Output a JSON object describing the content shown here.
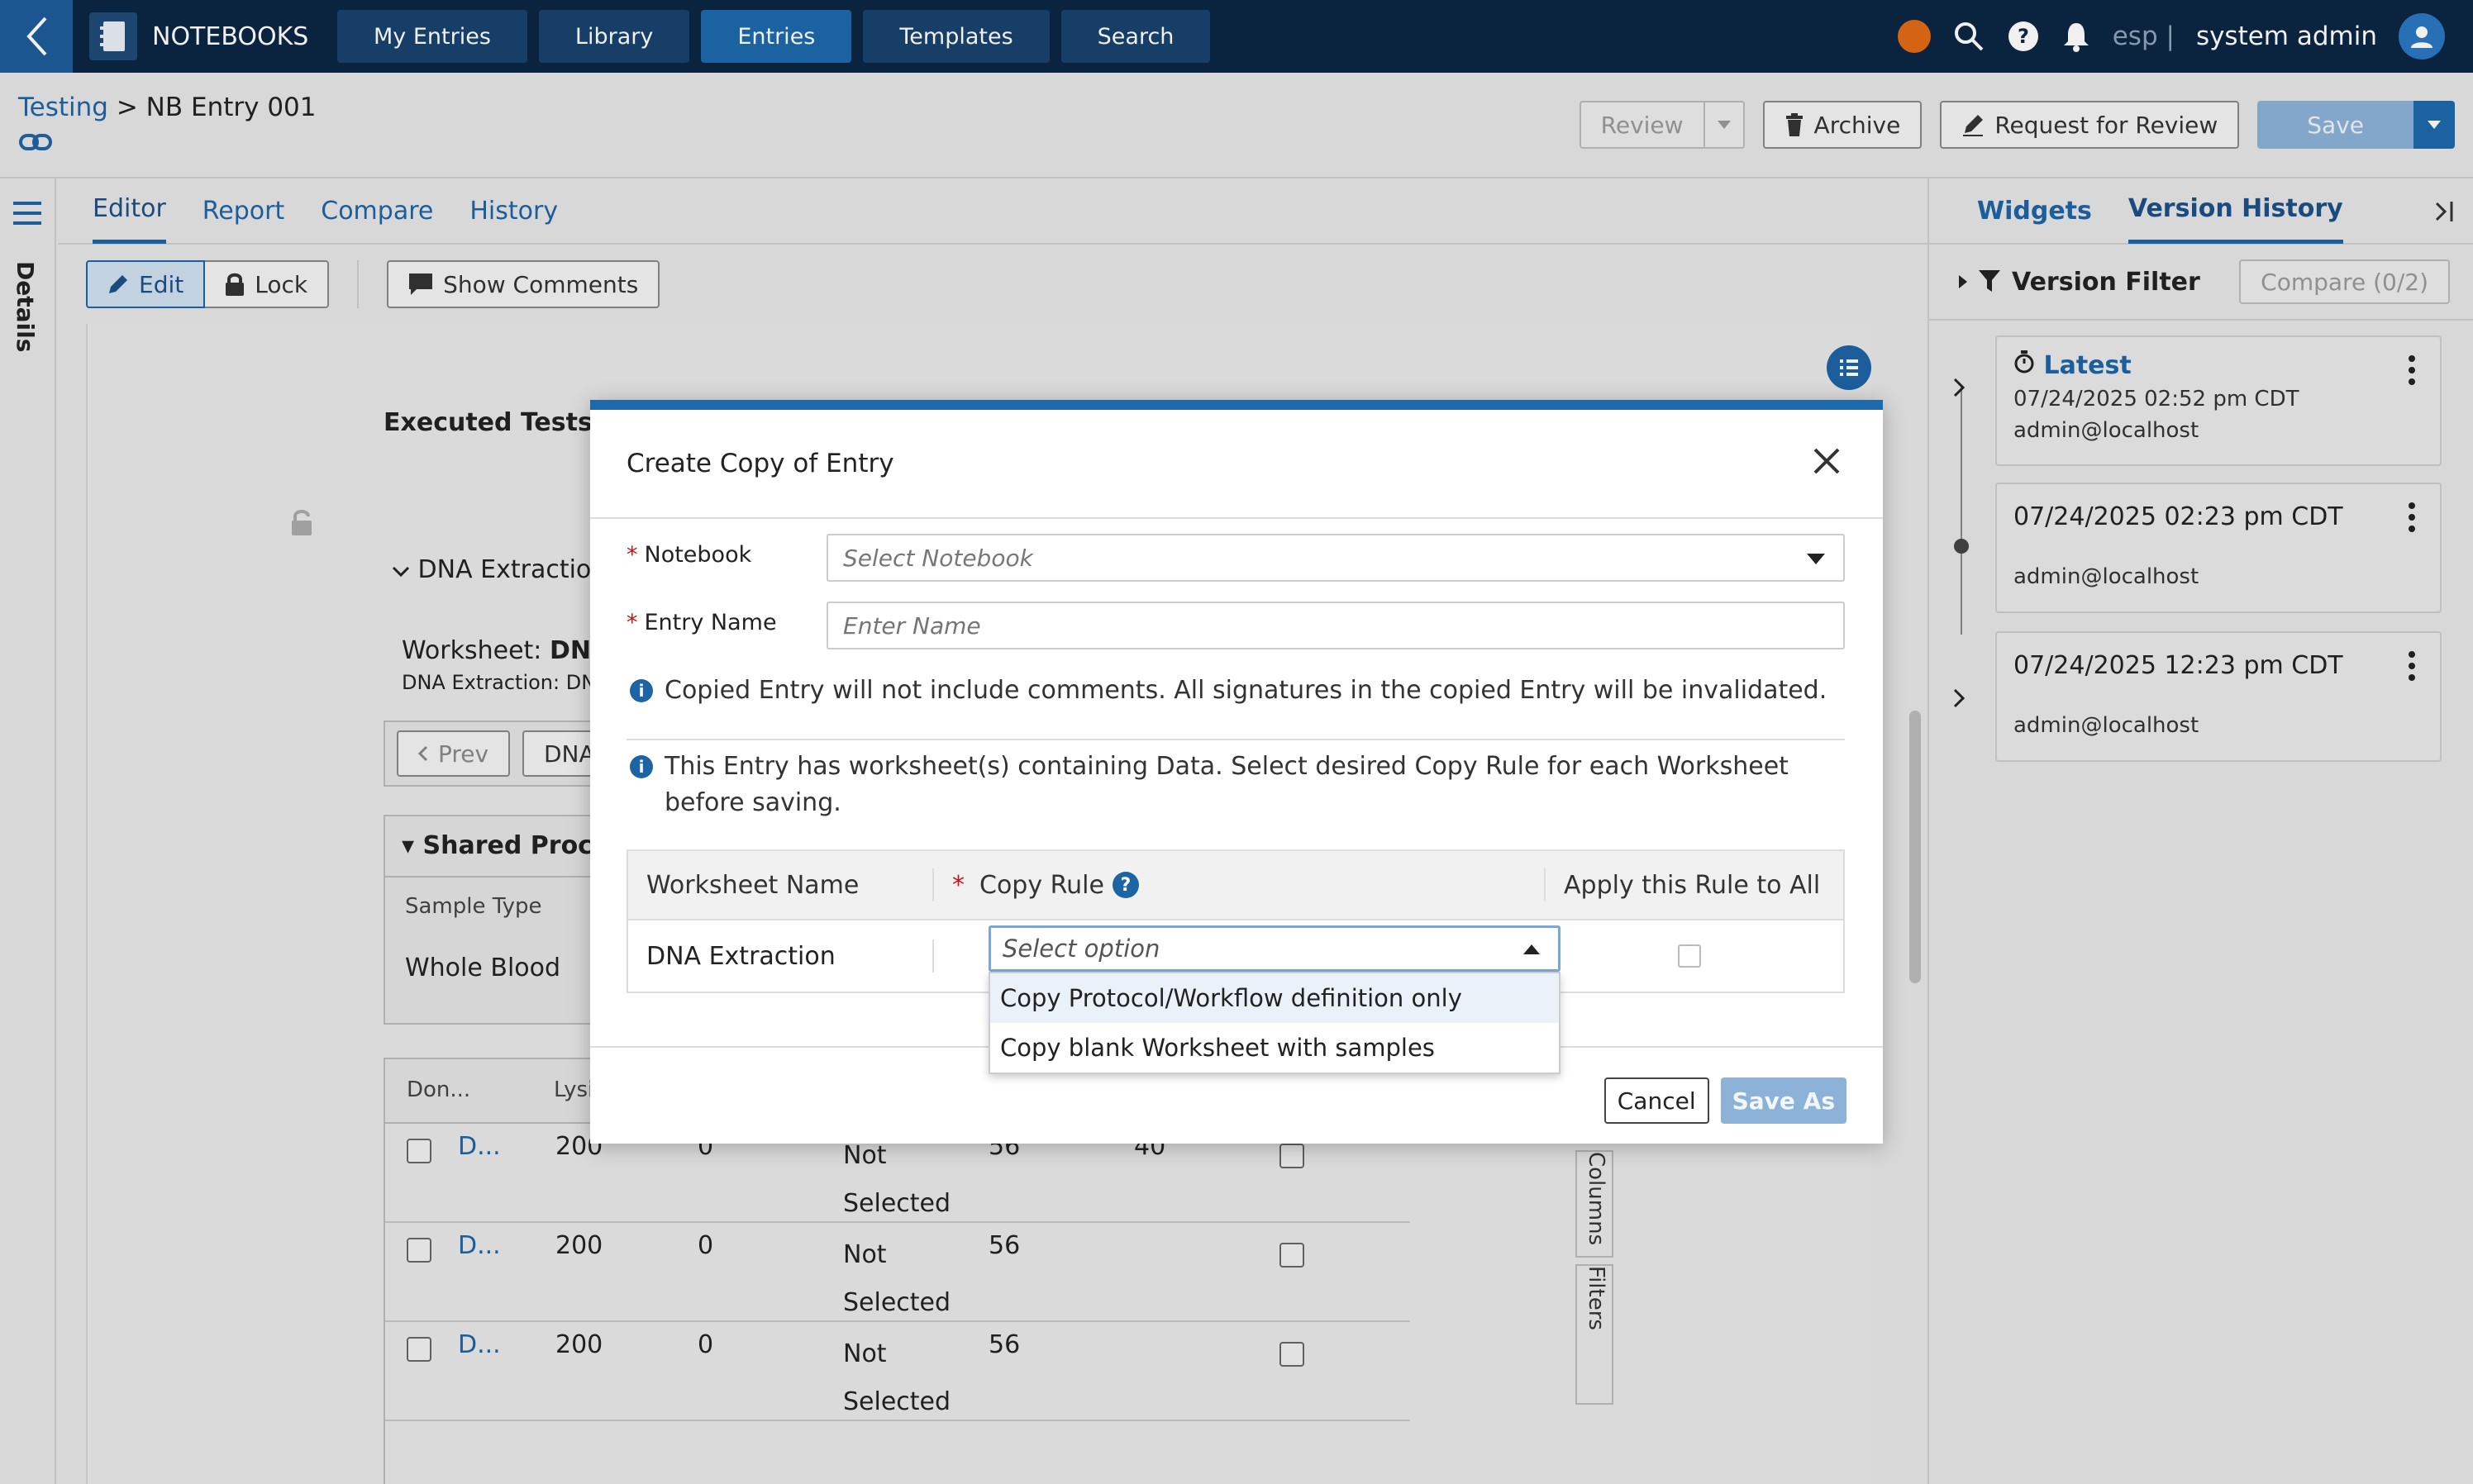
{
  "topbar": {
    "brand": "NOTEBOOKS",
    "nav": [
      "My Entries",
      "Library",
      "Entries",
      "Templates",
      "Search"
    ],
    "active_nav": "Entries",
    "lang": "esp",
    "lang_sep": "|",
    "user": "system admin",
    "accent": "#1d6aaa",
    "bg": "#0b2745"
  },
  "breadcrumb": {
    "parent": "Testing",
    "sep": " > ",
    "current": "NB Entry 001"
  },
  "header_actions": {
    "review": "Review",
    "archive": "Archive",
    "request_review": "Request for Review",
    "save": "Save"
  },
  "rail": {
    "details": "Details"
  },
  "editor_tabs": [
    "Editor",
    "Report",
    "Compare",
    "History"
  ],
  "toolbar": {
    "edit": "Edit",
    "lock": "Lock",
    "show_comments": "Show Comments"
  },
  "background": {
    "executed_tests": "Executed Tests",
    "dna_extraction": "DNA Extractio",
    "worksheet_label": "Worksheet: ",
    "worksheet_bold": "DNA",
    "worksheet_sub": "DNA Extraction: DN",
    "prev": "Prev",
    "dna_btn": "DNA",
    "shared_proc": "Shared Proc",
    "sample_type": "Sample Type",
    "whole_blood": "Whole Blood",
    "col_don": "Don...",
    "col_lysi": "Lysi",
    "rows": [
      {
        "id": "D...",
        "a": "200",
        "b": "0",
        "c": "Not Selected",
        "d": "56",
        "e": "40"
      },
      {
        "id": "D...",
        "a": "200",
        "b": "0",
        "c": "Not Selected",
        "d": "56",
        "e": ""
      },
      {
        "id": "D...",
        "a": "200",
        "b": "0",
        "c": "Not Selected",
        "d": "56",
        "e": ""
      }
    ],
    "columns_tab": "Columns",
    "filters_tab": "Filters"
  },
  "right_panel": {
    "tabs": [
      "Widgets",
      "Version History"
    ],
    "version_filter": "Version Filter",
    "compare": "Compare (0/2)",
    "versions": [
      {
        "title": "Latest",
        "date": "07/24/2025 02:52 pm CDT",
        "user": "admin@localhost"
      },
      {
        "title": "07/24/2025 02:23 pm CDT",
        "user": "admin@localhost"
      },
      {
        "title": "07/24/2025 12:23 pm CDT",
        "user": "admin@localhost"
      }
    ]
  },
  "modal": {
    "title": "Create Copy of Entry",
    "notebook_label": "Notebook",
    "notebook_placeholder": "Select Notebook",
    "entry_name_label": "Entry Name",
    "entry_name_placeholder": "Enter Name",
    "info1": "Copied Entry will not include comments. All signatures in the copied Entry will be invalidated.",
    "info2": "This Entry has worksheet(s) containing Data. Select desired Copy Rule for each Worksheet before saving.",
    "table": {
      "col_worksheet": "Worksheet Name",
      "col_copy_rule": "Copy Rule",
      "col_apply": "Apply this Rule to All",
      "row_name": "DNA Extraction",
      "select_placeholder": "Select option",
      "options": [
        "Copy Protocol/Workflow definition only",
        "Copy blank Worksheet with samples"
      ]
    },
    "cancel": "Cancel",
    "save_as": "Save As"
  }
}
